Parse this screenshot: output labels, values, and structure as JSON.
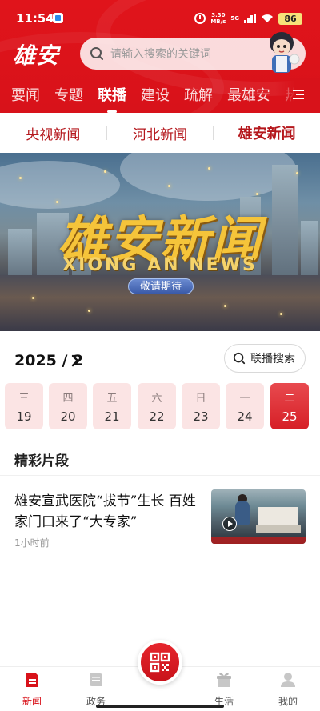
{
  "status_bar": {
    "time": "11:54",
    "speed_value": "3.30",
    "speed_unit": "MB/s",
    "network": "5G",
    "battery": "86"
  },
  "header": {
    "logo": "雄安",
    "search_placeholder": "请输入搜索的关键词",
    "channels": [
      "要闻",
      "专题",
      "联播",
      "建设",
      "疏解",
      "最雄安",
      "热"
    ],
    "active_channel": "联播"
  },
  "sub_tabs": {
    "items": [
      "央视新闻",
      "河北新闻",
      "雄安新闻"
    ],
    "active": "雄安新闻"
  },
  "banner": {
    "title": "雄安新闻",
    "subtitle": "XIONG AN NEWS",
    "badge": "敬请期待"
  },
  "date_picker": {
    "current_month": "2025 / 2",
    "search_button": "联播搜索",
    "days": [
      {
        "weekday": "三",
        "date": "19"
      },
      {
        "weekday": "四",
        "date": "20"
      },
      {
        "weekday": "五",
        "date": "21"
      },
      {
        "weekday": "六",
        "date": "22"
      },
      {
        "weekday": "日",
        "date": "23"
      },
      {
        "weekday": "一",
        "date": "24"
      },
      {
        "weekday": "二",
        "date": "25"
      }
    ],
    "selected_date": "25"
  },
  "highlights": {
    "section_title": "精彩片段",
    "articles": [
      {
        "title": "雄安宣武医院“拔节”生长 百姓家门口来了“大专家”",
        "time": "1小时前"
      }
    ]
  },
  "bottom_nav": {
    "items": [
      {
        "label": "新闻",
        "icon": "news-icon"
      },
      {
        "label": "政务",
        "icon": "government-icon"
      },
      {
        "label": "",
        "icon": "qr-scan-icon"
      },
      {
        "label": "生活",
        "icon": "life-gift-icon"
      },
      {
        "label": "我的",
        "icon": "profile-icon"
      }
    ],
    "active": "新闻"
  },
  "colors": {
    "brand_red": "#d8121a",
    "tab_red": "#b5171c",
    "date_bg": "#fbe4e4"
  }
}
